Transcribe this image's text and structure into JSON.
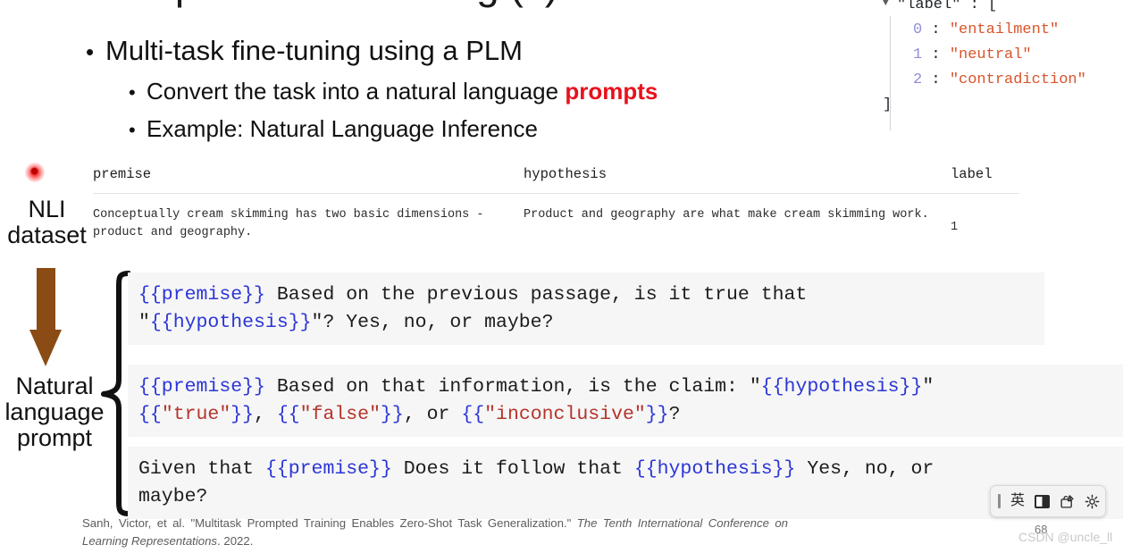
{
  "slide": {
    "cut_title": "Prompt-based Learning (II)",
    "slide_number": "68",
    "watermark": "CSDN @uncle_ll"
  },
  "bullets": {
    "level1": "Multi-task fine-tuning using a PLM",
    "level2": [
      {
        "pre": "Convert the task into a natural language ",
        "highlight": "prompts",
        "post": ""
      },
      {
        "pre": "Example: Natural Language Inference",
        "highlight": "",
        "post": ""
      }
    ],
    "bullet_glyph": "•"
  },
  "annotations": {
    "dataset_label": "NLI\ndataset",
    "dataset_label_line1": "NLI",
    "dataset_label_line2": "dataset",
    "prompt_label_line1": "Natural",
    "prompt_label_line2": "language",
    "prompt_label_line3": "prompt",
    "arrow_color": "#8a4b14",
    "laser_color": "#ff0000"
  },
  "json_viewer": {
    "toggle_glyph": "▼",
    "root_key": "\"label\"",
    "root_punct": " : [",
    "close_bracket": "]",
    "entries": [
      {
        "index": "0",
        "colon": " : ",
        "value": "\"entailment\""
      },
      {
        "index": "1",
        "colon": " : ",
        "value": "\"neutral\""
      },
      {
        "index": "2",
        "colon": " : ",
        "value": "\"contradiction\""
      }
    ],
    "index_color": "#8f8fd6",
    "value_color": "#d9542b"
  },
  "dataset_table": {
    "columns": [
      "premise",
      "hypothesis",
      "label"
    ],
    "rows": [
      {
        "premise": "Conceptually cream skimming has two basic dimensions - product and geography.",
        "hypothesis": "Product and geography are what make cream skimming work.",
        "label": "1"
      }
    ]
  },
  "prompt_templates": [
    {
      "id": "prompt-template-1",
      "line1": [
        {
          "text": "{{premise}}",
          "style": "var"
        },
        {
          "text": " Based on the previous passage, is it true that",
          "style": "plain"
        }
      ],
      "line2": [
        {
          "text": "\"",
          "style": "plain"
        },
        {
          "text": "{{hypothesis}}",
          "style": "var"
        },
        {
          "text": "\"? Yes, no, or maybe?",
          "style": "plain"
        }
      ]
    },
    {
      "id": "prompt-template-2",
      "line1": [
        {
          "text": "{{premise}}",
          "style": "var"
        },
        {
          "text": " Based on that information, is the claim: \"",
          "style": "plain"
        },
        {
          "text": "{{hypothesis}}",
          "style": "var"
        },
        {
          "text": "\"",
          "style": "plain"
        }
      ],
      "line2": [
        {
          "text": "{{",
          "style": "var"
        },
        {
          "text": "\"true\"",
          "style": "red"
        },
        {
          "text": "}}",
          "style": "var"
        },
        {
          "text": ", ",
          "style": "plain"
        },
        {
          "text": "{{",
          "style": "var"
        },
        {
          "text": "\"false\"",
          "style": "red"
        },
        {
          "text": "}}",
          "style": "var"
        },
        {
          "text": ", or ",
          "style": "plain"
        },
        {
          "text": "{{",
          "style": "var"
        },
        {
          "text": "\"inconclusive\"",
          "style": "red"
        },
        {
          "text": "}}",
          "style": "var"
        },
        {
          "text": "?",
          "style": "plain"
        }
      ]
    },
    {
      "id": "prompt-template-3",
      "line1": [
        {
          "text": "Given that ",
          "style": "plain"
        },
        {
          "text": "{{premise}}",
          "style": "var"
        },
        {
          "text": " Does it follow that ",
          "style": "plain"
        },
        {
          "text": "{{hypothesis}}",
          "style": "var"
        },
        {
          "text": " Yes, no, or",
          "style": "plain"
        }
      ],
      "line2": [
        {
          "text": "maybe?",
          "style": "plain"
        }
      ]
    }
  ],
  "citation": {
    "part1": "Sanh, Victor, et al. \"Multitask Prompted Training Enables Zero-Shot Task Generalization.\" ",
    "italic": "The Tenth International Conference on Learning Representations",
    "part2": ". 2022."
  },
  "ime_toolbar": {
    "language_mode": "英",
    "items": [
      "drag-handle",
      "language-mode",
      "width-mode",
      "toolbox",
      "settings"
    ]
  }
}
